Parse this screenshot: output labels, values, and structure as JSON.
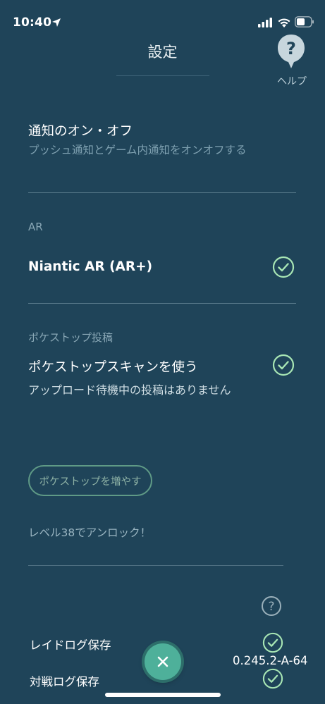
{
  "status_bar": {
    "time": "10:40"
  },
  "header": {
    "title": "設定",
    "help_label": "ヘルプ",
    "help_icon_glyph": "?"
  },
  "notifications": {
    "title": "通知のオン・オフ",
    "subtitle": "プッシュ通知とゲーム内通知をオンオフする"
  },
  "ar": {
    "section_label": "AR",
    "item_title": "Niantic AR (AR+)",
    "checked": true
  },
  "pokestop": {
    "section_label": "ポケストップ投稿",
    "item_title": "ポケストップスキャンを使う",
    "checked": true,
    "subtitle": "アップロード待機中の投稿はありません",
    "boost_button": "ポケストップを増やす",
    "unlock_note": "レベル38でアンロック！"
  },
  "logs": {
    "info_icon_glyph": "?",
    "raid_log_label": "レイドログ保存",
    "raid_log_checked": true,
    "battle_log_label": "対戦ログ保存",
    "battle_log_checked": true
  },
  "version": "0.245.2-A-64",
  "colors": {
    "background": "#1f4459",
    "check": "#a8e6b4",
    "divider": "#587a8b",
    "close_button": "#4eb09a"
  }
}
